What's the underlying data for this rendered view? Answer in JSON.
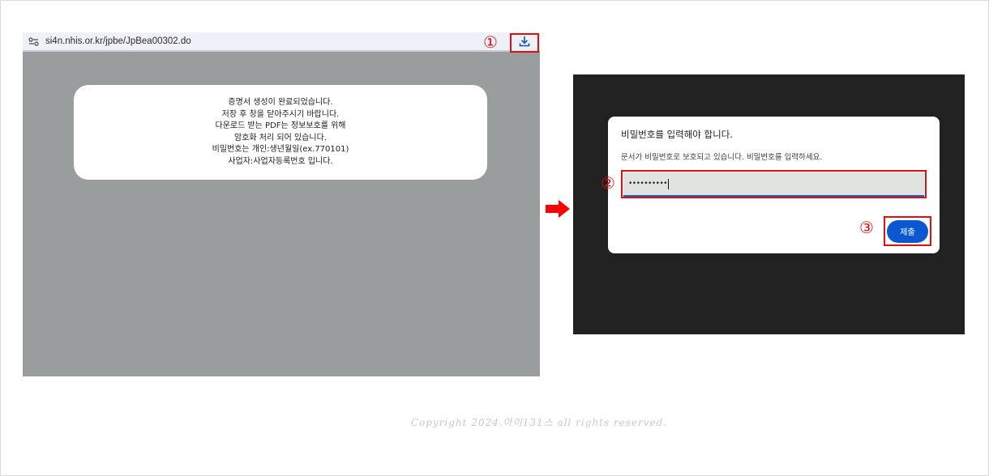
{
  "browser": {
    "url": "si4n.nhis.or.kr/jpbe/JpBea00302.do",
    "icons": {
      "site_info": "tune-icon",
      "download": "download-icon"
    }
  },
  "steps": {
    "one": "①",
    "two": "②",
    "three": "③"
  },
  "notice": {
    "lines": [
      "증명서 생성이 완료되었습니다.",
      "저장 후 창을 닫아주시기 바랍니다.",
      "다운로드 받는 PDF는 정보보호를 위해",
      "암호화 처리 되어 있습니다.",
      "비밀번호는 개인:생년월일(ex.770101)",
      "사업자:사업자등록번호 입니다."
    ]
  },
  "password_dialog": {
    "title": "비밀번호를 입력해야 합니다.",
    "description": "문서가 비밀번호로 보호되고 있습니다. 비밀번호를 입력하세요.",
    "input_value": "••••••••••",
    "submit_label": "제출"
  },
  "copyright": "Copyright 2024.아이131스 all rights reserved.",
  "colors": {
    "highlight": "#e01010",
    "submit": "#0b57d0",
    "left_background": "#9a9d9e",
    "right_background": "#212121"
  }
}
